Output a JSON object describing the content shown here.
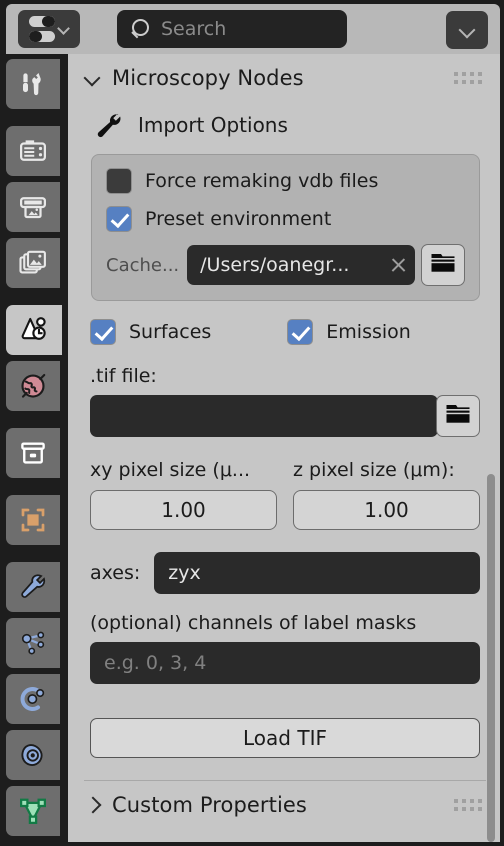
{
  "topbar": {
    "editor_type_button": "editor-type-selector",
    "search": {
      "placeholder": "Search",
      "value": ""
    },
    "dropdown_button": "options-dropdown"
  },
  "sidebar": {
    "tabs": [
      {
        "name": "tool",
        "icon": "tool-icon",
        "active": false
      },
      {
        "name": "render",
        "icon": "camera-icon",
        "active": false
      },
      {
        "name": "output",
        "icon": "printer-icon",
        "active": false
      },
      {
        "name": "view-layer",
        "icon": "images-icon",
        "active": false
      },
      {
        "name": "scene",
        "icon": "scene-cone-icon",
        "active": true
      },
      {
        "name": "world",
        "icon": "world-globe-icon",
        "active": false
      },
      {
        "name": "collection",
        "icon": "collection-box-icon",
        "active": false
      },
      {
        "name": "object",
        "icon": "object-square-icon",
        "active": false
      },
      {
        "name": "modifiers",
        "icon": "wrench-icon",
        "active": false
      },
      {
        "name": "particles",
        "icon": "particles-nodes-icon",
        "active": false
      },
      {
        "name": "physics",
        "icon": "physics-orbit-icon",
        "active": false
      },
      {
        "name": "constraints",
        "icon": "constraint-icon",
        "active": false
      },
      {
        "name": "object-data",
        "icon": "mesh-data-icon",
        "active": false
      }
    ]
  },
  "panel": {
    "title": "Microscopy Nodes",
    "expanded": true,
    "import_options": {
      "section_label": "Import Options",
      "section_icon": "wrench-icon",
      "checkboxes": [
        {
          "label": "Force remaking vdb files",
          "checked": false
        },
        {
          "label": "Preset environment",
          "checked": true
        }
      ],
      "cache": {
        "label": "Cache...",
        "value": "/Users/oanegr...",
        "clear_icon": "x-icon",
        "browse_icon": "folder-icon"
      }
    },
    "toggles": [
      {
        "label": "Surfaces",
        "checked": true
      },
      {
        "label": "Emission",
        "checked": true
      }
    ],
    "tif_file": {
      "label": ".tif file:",
      "value": "",
      "browse_icon": "folder-icon"
    },
    "pixel_sizes": [
      {
        "label": "xy pixel size (μ...",
        "value": "1.00"
      },
      {
        "label": "z pixel size (μm):",
        "value": "1.00"
      }
    ],
    "axes": {
      "label": "axes:",
      "value": "zyx"
    },
    "label_masks": {
      "label": "(optional) channels of label masks",
      "value": "",
      "placeholder": "e.g. 0, 3, 4"
    },
    "load_button": "Load TIF"
  },
  "custom_properties": {
    "title": "Custom Properties",
    "expanded": false
  },
  "colors": {
    "panel_bg": "#c6c6c6",
    "window_bg": "#1d1d1d",
    "tab_bg": "#6e6e6e",
    "checkbox_on": "#5680c2",
    "field_dark": "#2a2a2a",
    "button_light": "#d9d9d9",
    "optbox_bg": "#b2b2b2"
  }
}
